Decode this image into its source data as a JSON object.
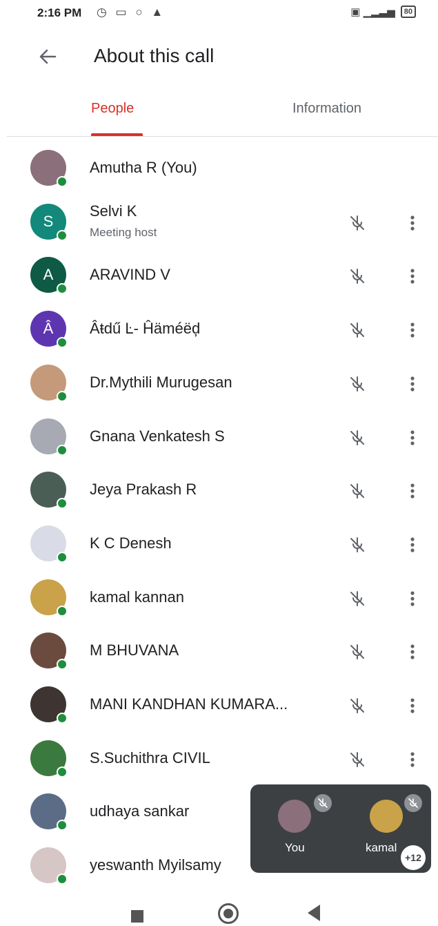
{
  "status_bar": {
    "time": "2:16 PM",
    "left_icons": "◷ ▭ ○ ▲",
    "right_icons": "▣ ▁▂▃▅",
    "battery": "80"
  },
  "header": {
    "title": "About this call"
  },
  "tabs": [
    {
      "label": "People",
      "active": true
    },
    {
      "label": "Information",
      "active": false
    }
  ],
  "participants": [
    {
      "name": "Amutha R (You)",
      "subtitle": "",
      "avatar_letter": "",
      "avatar_color": "#8b6f7a",
      "show_controls": false
    },
    {
      "name": "Selvi K",
      "subtitle": "Meeting host",
      "avatar_letter": "S",
      "avatar_color": "#12897a",
      "show_controls": true
    },
    {
      "name": "ARAVIND V",
      "subtitle": "",
      "avatar_letter": "A",
      "avatar_color": "#0e5a44",
      "show_controls": true
    },
    {
      "name": "Âŧdű Ŀ- Ĥäméëḑ",
      "subtitle": "",
      "avatar_letter": "Â",
      "avatar_color": "#5e35b1",
      "show_controls": true
    },
    {
      "name": "Dr.Mythili Murugesan",
      "subtitle": "",
      "avatar_letter": "",
      "avatar_color": "#c49a7a",
      "show_controls": true
    },
    {
      "name": "Gnana Venkatesh S",
      "subtitle": "",
      "avatar_letter": "",
      "avatar_color": "#a7a9b3",
      "show_controls": true
    },
    {
      "name": "Jeya Prakash R",
      "subtitle": "",
      "avatar_letter": "",
      "avatar_color": "#4a5e55",
      "show_controls": true
    },
    {
      "name": "K C Denesh",
      "subtitle": "",
      "avatar_letter": "",
      "avatar_color": "#d9dce6",
      "show_controls": true
    },
    {
      "name": "kamal kannan",
      "subtitle": "",
      "avatar_letter": "",
      "avatar_color": "#c9a24a",
      "show_controls": true
    },
    {
      "name": "M BHUVANA",
      "subtitle": "",
      "avatar_letter": "",
      "avatar_color": "#6b4b3e",
      "show_controls": true
    },
    {
      "name": "MANI KANDHAN KUMARA...",
      "subtitle": "",
      "avatar_letter": "",
      "avatar_color": "#3e3431",
      "show_controls": true
    },
    {
      "name": "S.Suchithra CIVIL",
      "subtitle": "",
      "avatar_letter": "",
      "avatar_color": "#3b7a3e",
      "show_controls": true
    },
    {
      "name": "udhaya sankar",
      "subtitle": "",
      "avatar_letter": "",
      "avatar_color": "#5b6d86",
      "show_controls": false
    },
    {
      "name": "yeswanth Myilsamy",
      "subtitle": "",
      "avatar_letter": "",
      "avatar_color": "#d7c6c6",
      "show_controls": false
    }
  ],
  "pip": {
    "tiles": [
      {
        "label": "You",
        "avatar_color": "#8b6f7a"
      },
      {
        "label": "kamal",
        "avatar_color": "#c9a24a"
      }
    ],
    "extra_count": "+12"
  },
  "colors": {
    "accent": "#d93025",
    "online": "#1e8e3e",
    "pip_background": "#3c4043"
  }
}
